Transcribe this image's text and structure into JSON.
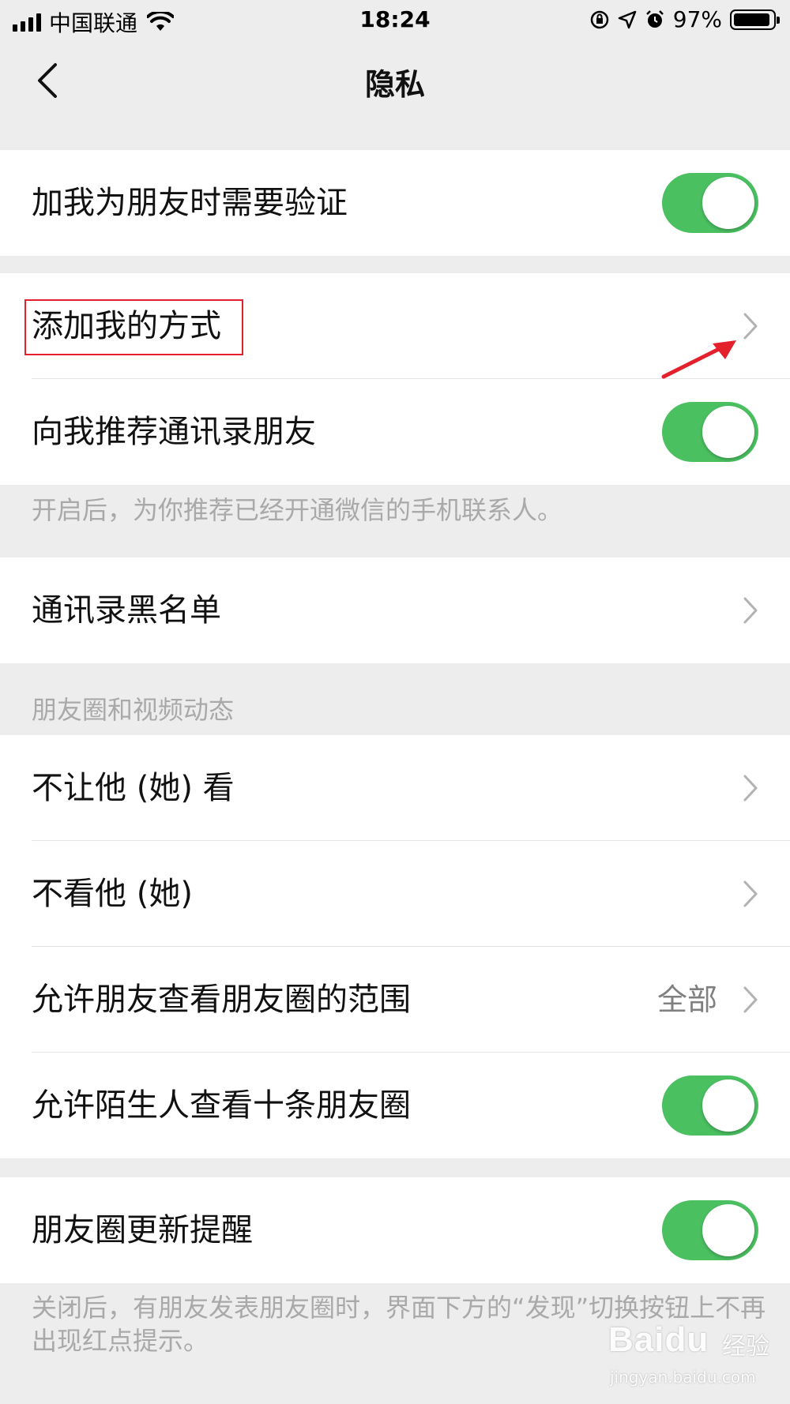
{
  "status_bar": {
    "carrier": "中国联通",
    "time": "18:24",
    "battery_percent": "97%",
    "battery_level": 0.97,
    "icons": [
      "signal-icon",
      "wifi-icon",
      "orientation-lock-icon",
      "location-icon",
      "alarm-icon",
      "battery-icon"
    ]
  },
  "nav": {
    "title": "隐私",
    "back_icon": "chevron-left-icon"
  },
  "groups": {
    "g1": {
      "verify": {
        "label": "加我为朋友时需要验证",
        "on": true
      }
    },
    "g2": {
      "add_methods": {
        "label": "添加我的方式"
      },
      "recommend_contacts": {
        "label": "向我推荐通讯录朋友",
        "on": true
      },
      "caption": "开启后，为你推荐已经开通微信的手机联系人。"
    },
    "g3": {
      "blacklist": {
        "label": "通讯录黑名单"
      }
    },
    "moments_header": "朋友圈和视频动态",
    "g4": {
      "hide_my_posts": {
        "label": "不让他 (她) 看"
      },
      "hide_their_posts": {
        "label": "不看他 (她)"
      },
      "visible_range": {
        "label": "允许朋友查看朋友圈的范围",
        "value": "全部"
      },
      "strangers_ten": {
        "label": "允许陌生人查看十条朋友圈",
        "on": true
      }
    },
    "g5": {
      "update_reminder": {
        "label": "朋友圈更新提醒",
        "on": true
      },
      "caption": "关闭后，有朋友发表朋友圈时，界面下方的“发现”切换按钮上不再出现红点提示。"
    }
  },
  "annotation": {
    "color": "#e3202b"
  },
  "colors": {
    "toggle_on": "#4bc061",
    "background": "#ededed",
    "caption": "#a9a9a9"
  },
  "watermark": {
    "brand": "Baidu",
    "sub": "经验",
    "url": "jingyan.baidu.com"
  }
}
